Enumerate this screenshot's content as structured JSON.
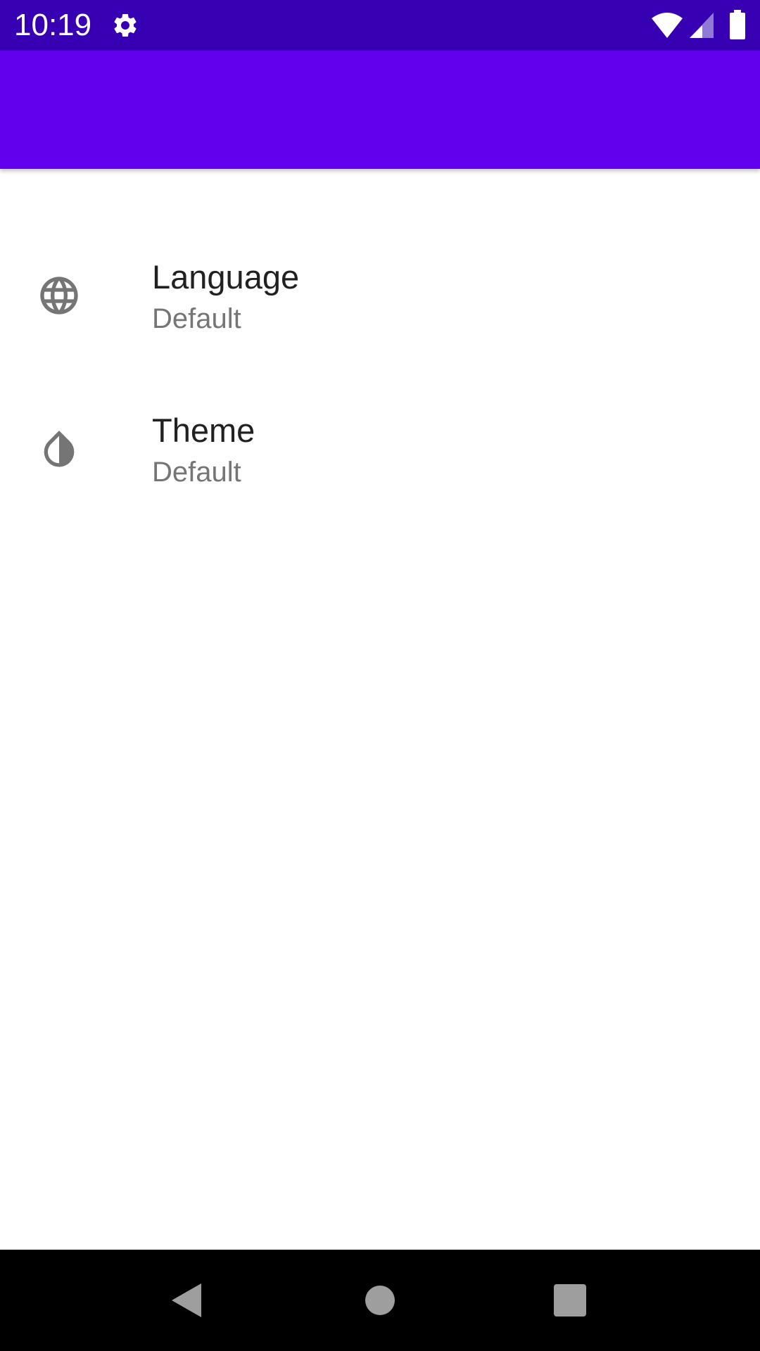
{
  "status_bar": {
    "time": "10:19",
    "icons": [
      "gear-icon",
      "wifi-icon",
      "signal-icon",
      "battery-icon"
    ],
    "background": "#3700b3"
  },
  "app_bar": {
    "background": "#6200ee"
  },
  "preferences": [
    {
      "icon": "globe-icon",
      "title": "Language",
      "summary": "Default"
    },
    {
      "icon": "invert-colors-icon",
      "title": "Theme",
      "summary": "Default"
    }
  ],
  "nav_bar": {
    "buttons": [
      "back-icon",
      "home-icon",
      "recents-icon"
    ]
  },
  "colors": {
    "accent": "#6200ee",
    "status": "#3700b3",
    "title_text": "#212121",
    "summary_text": "#757575",
    "icon": "#757575"
  }
}
